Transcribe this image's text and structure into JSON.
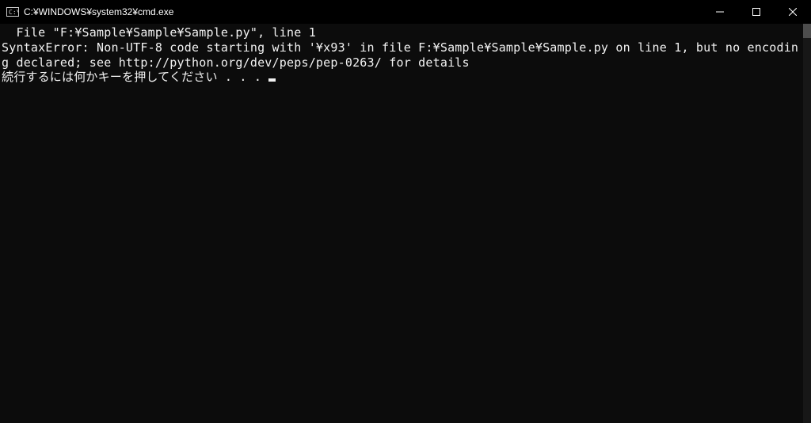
{
  "window": {
    "title": "C:¥WINDOWS¥system32¥cmd.exe"
  },
  "terminal": {
    "lines": [
      "  File \"F:¥Sample¥Sample¥Sample.py\", line 1",
      "SyntaxError: Non-UTF-8 code starting with '¥x93' in file F:¥Sample¥Sample¥Sample.py on line 1, but no encoding declared; see http://python.org/dev/peps/pep-0263/ for details",
      "続行するには何かキーを押してください . . . "
    ]
  }
}
